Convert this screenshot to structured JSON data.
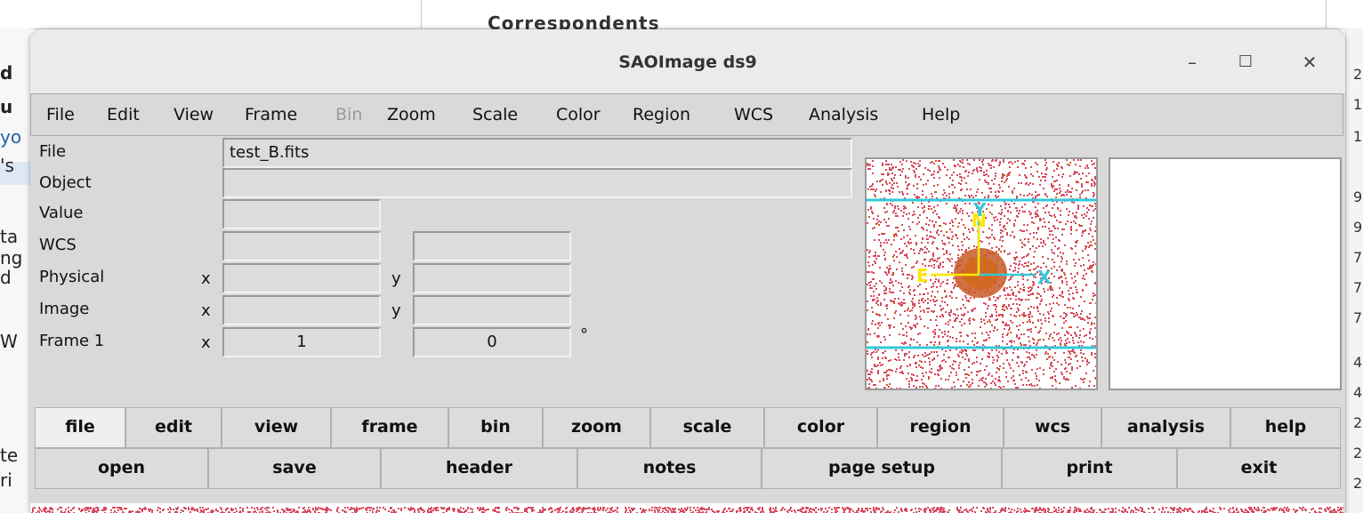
{
  "background": {
    "panel_title": "Correspondents",
    "left_fragments": [
      "d",
      "u",
      "yo",
      "'s",
      "ta",
      "ng",
      "d",
      "W",
      "te",
      "ri"
    ],
    "right_fragments": [
      "2",
      "1",
      "1",
      "9",
      "9",
      "7",
      "7",
      "7",
      "4",
      "4",
      "2",
      "2",
      "2"
    ]
  },
  "window": {
    "title": "SAOImage ds9",
    "controls": {
      "minimize": "–",
      "maximize": "☐",
      "close": "✕"
    }
  },
  "menubar": {
    "items": [
      {
        "label": "File",
        "enabled": true
      },
      {
        "label": "Edit",
        "enabled": true
      },
      {
        "label": "View",
        "enabled": true
      },
      {
        "label": "Frame",
        "enabled": true
      },
      {
        "label": "Bin",
        "enabled": false
      },
      {
        "label": "Zoom",
        "enabled": true
      },
      {
        "label": "Scale",
        "enabled": true
      },
      {
        "label": "Color",
        "enabled": true
      },
      {
        "label": "Region",
        "enabled": true
      },
      {
        "label": "WCS",
        "enabled": true
      },
      {
        "label": "Analysis",
        "enabled": true
      },
      {
        "label": "Help",
        "enabled": true
      }
    ]
  },
  "info": {
    "file_label": "File",
    "file_value": "test_B.fits",
    "object_label": "Object",
    "object_value": "",
    "value_label": "Value",
    "value_value": "",
    "wcs_label": "WCS",
    "wcs_x": "",
    "wcs_y": "",
    "physical_label": "Physical",
    "physical_x_label": "x",
    "physical_y_label": "y",
    "image_label": "Image",
    "image_x_label": "x",
    "image_y_label": "y",
    "frame_label": "Frame 1",
    "frame_x_label": "x",
    "frame_zoom": "1",
    "frame_angle": "0",
    "degree_symbol": "°"
  },
  "panner": {
    "compass_north": "N",
    "compass_east": "E",
    "axis_x": "X",
    "axis_y": "Y",
    "colors": {
      "noise": "#d84a5e",
      "source": "#cc5a20",
      "compass": "#ffe600",
      "axes": "#33c8d8",
      "bbox": "#33c8d8"
    }
  },
  "buttonbar": {
    "top_row": [
      {
        "label": "file",
        "active": true
      },
      {
        "label": "edit",
        "active": false
      },
      {
        "label": "view",
        "active": false
      },
      {
        "label": "frame",
        "active": false
      },
      {
        "label": "bin",
        "active": false
      },
      {
        "label": "zoom",
        "active": false
      },
      {
        "label": "scale",
        "active": false
      },
      {
        "label": "color",
        "active": false
      },
      {
        "label": "region",
        "active": false
      },
      {
        "label": "wcs",
        "active": false
      },
      {
        "label": "analysis",
        "active": false
      },
      {
        "label": "help",
        "active": false
      }
    ],
    "bottom_row": [
      {
        "label": "open"
      },
      {
        "label": "save"
      },
      {
        "label": "header"
      },
      {
        "label": "notes"
      },
      {
        "label": "page setup"
      },
      {
        "label": "print"
      },
      {
        "label": "exit"
      }
    ]
  }
}
